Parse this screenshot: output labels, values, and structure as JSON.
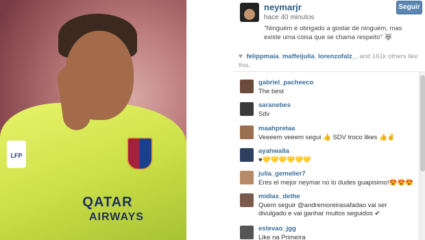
{
  "post": {
    "owner": "neymarjr",
    "time": "hace 40 minutos",
    "caption": "\"Ninguém é obrigado a gostar de ninguém, mas existe uma coisa que se chama respeito\" 🐺",
    "follow_label": "Seguir",
    "photo_sponsor": "QATAR",
    "photo_sponsor_sub": "AIRWAYS",
    "photo_badge": "LFP"
  },
  "likes": {
    "users": [
      "felippmaia",
      "maffeijulia",
      "lorenzofalz_"
    ],
    "rest": ", and 161k others like this."
  },
  "comments": [
    {
      "user": "gabriel_pacheeco",
      "text": "The best"
    },
    {
      "user": "saranebes",
      "text": "Sdv"
    },
    {
      "user": "maahpretaa",
      "text": "Veeeem veeem segui 👍 SDV troco likes 👍✌"
    },
    {
      "user": "ayahwalla",
      "text": "♥💛💛💛💛💛💛"
    },
    {
      "user": "julia_gemelier7",
      "text": "Eres el mejor neymar no lo dudes guapisimo!😍😍😍"
    },
    {
      "user": "midias_dethe",
      "text": "Quem seguir @andremoreirasafadao vai ser divulgado e vai ganhar muitos seguidos ✔"
    },
    {
      "user": "estevao_jgg",
      "text": "Like na Primeira"
    }
  ]
}
